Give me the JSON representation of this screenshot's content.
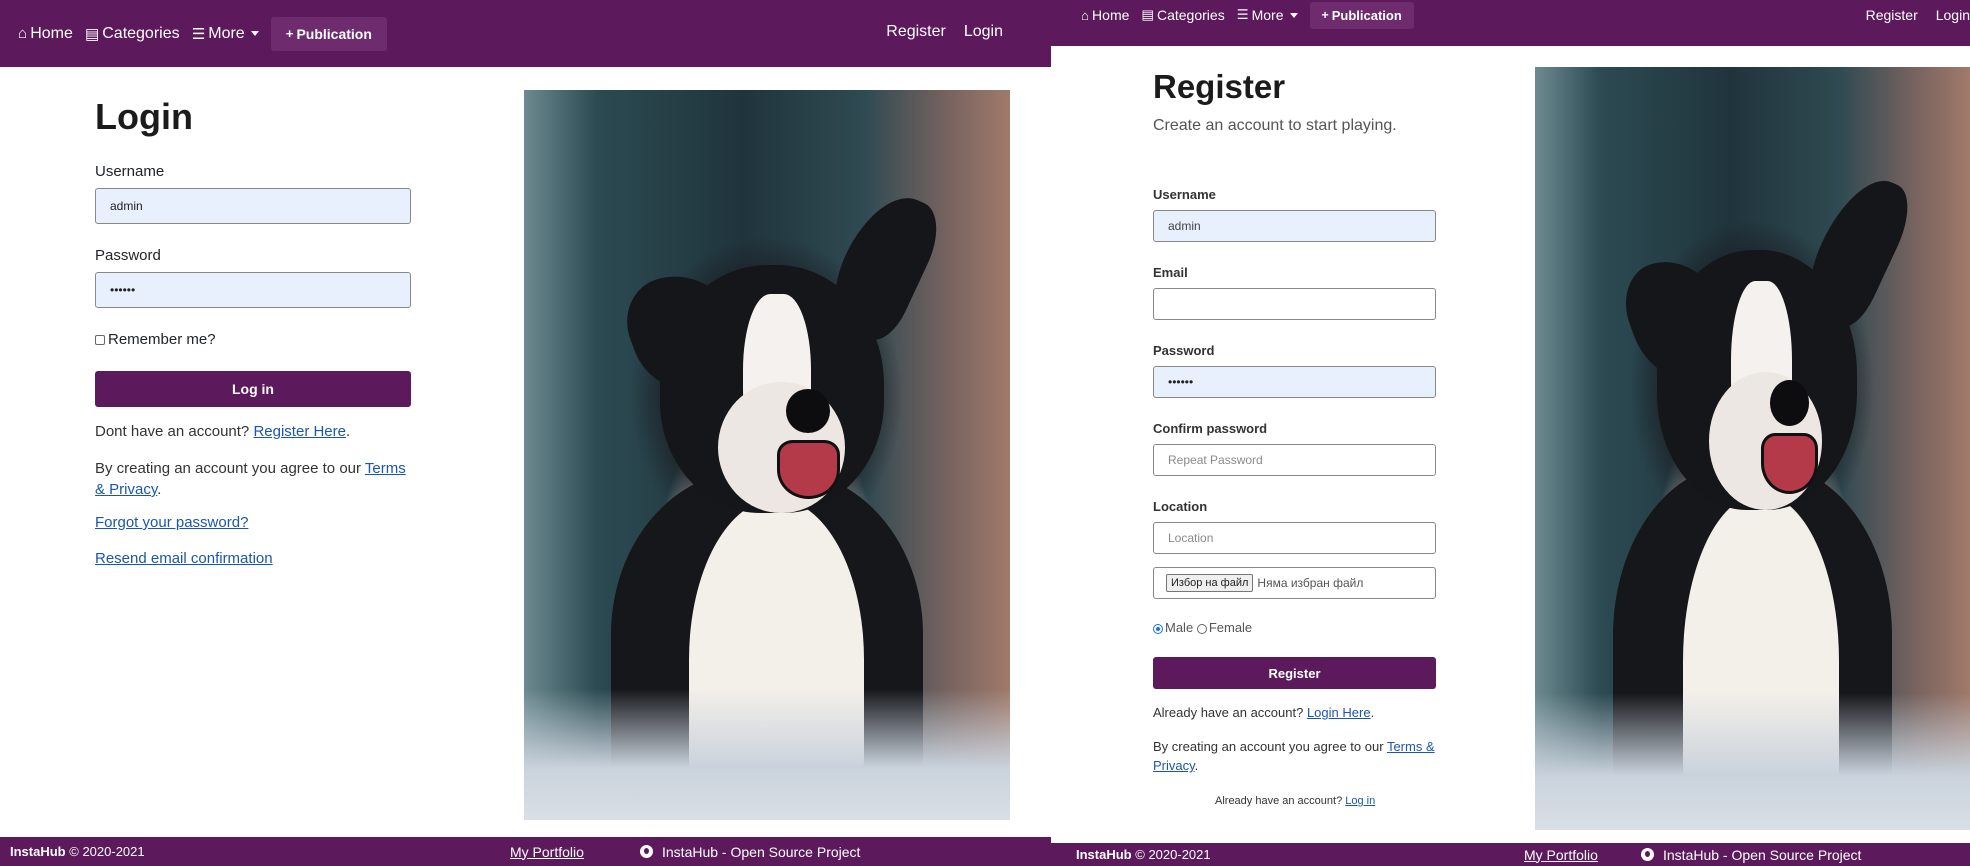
{
  "nav": {
    "home": "Home",
    "categories": "Categories",
    "more": "More",
    "publication": "Publication",
    "register": "Register",
    "login": "Login"
  },
  "icons": {
    "home": "home-icon",
    "categories": "book-icon",
    "more": "list-icon",
    "publication": "plus-icon",
    "github": "github-icon"
  },
  "brand_color": "#5c1a5c",
  "login_page": {
    "title": "Login",
    "username_label": "Username",
    "username_value": "admin",
    "password_label": "Password",
    "password_value": "••••••",
    "remember_label": "Remember me?",
    "submit_label": "Log in",
    "no_account_text": "Dont have an account?",
    "register_link": "Register Here",
    "terms_text": "By creating an account you agree to our",
    "terms_link": "Terms & Privacy",
    "forgot_link": "Forgot your password?",
    "resend_link": "Resend email confirmation"
  },
  "register_page": {
    "title": "Register",
    "subtitle": "Create an account to start playing.",
    "username_label": "Username",
    "username_value": "admin",
    "email_label": "Email",
    "email_value": "",
    "password_label": "Password",
    "password_value": "••••••",
    "confirm_label": "Confirm password",
    "confirm_placeholder": "Repeat Password",
    "location_label": "Location",
    "location_placeholder": "Location",
    "file_button": "Избор на файл",
    "file_status": "Няма избран файл",
    "gender_male": "Male",
    "gender_female": "Female",
    "submit_label": "Register",
    "have_account_text": "Already have an account?",
    "login_link": "Login Here",
    "terms_text": "By creating an account you agree to our",
    "terms_link": "Terms & Privacy",
    "small_have_account": "Already have an account?",
    "small_login_link": "Log in"
  },
  "footer": {
    "brand": "InstaHub",
    "copyright": "© 2020-2021",
    "portfolio": "My Portfolio",
    "github": "InstaHub - Open Source Project"
  }
}
